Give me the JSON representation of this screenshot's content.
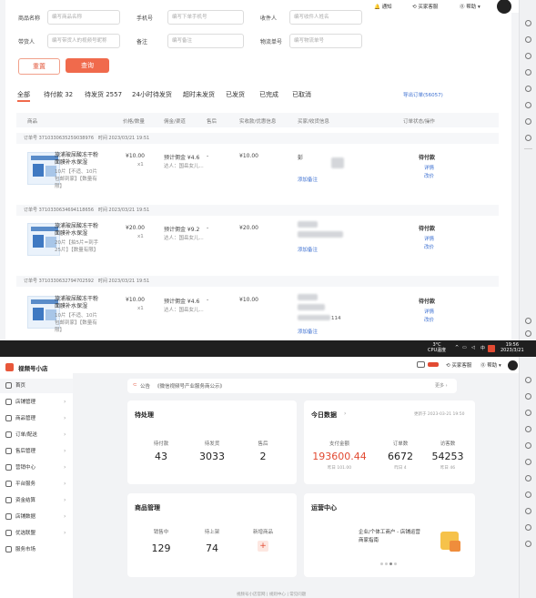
{
  "orders_page": {
    "header": {
      "notify": "通知",
      "service": "买家客服",
      "help": "帮助"
    },
    "filters": [
      {
        "label": "商品名称",
        "placeholder": "编写商品名称"
      },
      {
        "label": "手机号",
        "placeholder": "编写下单手机号"
      },
      {
        "label": "收件人",
        "placeholder": "编写收件人姓名"
      },
      {
        "label": "带货人",
        "placeholder": "编写带货人的视频号昵称"
      },
      {
        "label": "备注",
        "placeholder": "编写备注"
      },
      {
        "label": "物流单号",
        "placeholder": "编写物流单号"
      }
    ],
    "reset_label": "重置",
    "query_label": "查询",
    "tabs": [
      "全部",
      "待付款 32",
      "待发货 2557",
      "24小时待发货",
      "超时未发货",
      "已发货",
      "已完成",
      "已取消"
    ],
    "export_label": "导出订单(56057)",
    "columns": [
      "商品",
      "价格/数量",
      "佣金/渠道",
      "售后",
      "实收款/优惠信息",
      "买家/收货信息",
      "订单状态/操作"
    ],
    "orders": [
      {
        "order_no": "订单号 3710330635259038976",
        "time": "时间 2023/03/21 19:51",
        "title": "旅浦玻尿酸冻干粉面膜补水保湿",
        "sku": "10片【不适、10片包邮到家】【数量有限】",
        "price": "¥10.00",
        "qty": "x1",
        "commission": "预计佣金 ¥4.6",
        "channel": "达人：国岳女儿...",
        "aftersale": "-",
        "received": "¥10.00",
        "buyer": "彭",
        "address_tail": "",
        "remark": "添加备注",
        "status": "待付款",
        "action1": "详情",
        "action2": "改价"
      },
      {
        "order_no": "订单号 3710330634694118656",
        "time": "时间 2023/03/21 19:51",
        "title": "旅浦玻尿酸冻干粉面膜补水保湿",
        "sku": "20片【拍5片=到手25片】【数量有限】",
        "price": "¥20.00",
        "qty": "x1",
        "commission": "预计佣金 ¥9.2",
        "channel": "达人：国岳女儿...",
        "aftersale": "-",
        "received": "¥20.00",
        "buyer": "",
        "address_tail": "",
        "remark": "添加备注",
        "status": "待付款",
        "action1": "详情",
        "action2": "改价"
      },
      {
        "order_no": "订单号 3710330632794702592",
        "time": "时间 2023/03/21 19:51",
        "title": "旅浦玻尿酸冻干粉面膜补水保湿",
        "sku": "10片【不适、10片包邮到家】【数量有限】",
        "price": "¥10.00",
        "qty": "x1",
        "commission": "预计佣金 ¥4.6",
        "channel": "达人：国岳女儿...",
        "aftersale": "-",
        "received": "¥10.00",
        "buyer": "",
        "address_tail": "114",
        "remark": "添加备注",
        "status": "待付款",
        "action1": "详情",
        "action2": "改价"
      }
    ]
  },
  "taskbar": {
    "weather": "3°C",
    "weather_sub": "CPU温度",
    "time": "19:56",
    "date": "2023/3/21"
  },
  "dashboard": {
    "app_name": "视频号小店",
    "header": {
      "service": "买家客服",
      "help": "帮助"
    },
    "sidebar": [
      {
        "label": "首页",
        "chev": ""
      },
      {
        "label": "店铺管理",
        "chev": "›"
      },
      {
        "label": "商品管理",
        "chev": "›"
      },
      {
        "label": "订单/配送",
        "chev": "›"
      },
      {
        "label": "售后管理",
        "chev": "›"
      },
      {
        "label": "营销中心",
        "chev": "›"
      },
      {
        "label": "平台服务",
        "chev": "›"
      },
      {
        "label": "资金结算",
        "chev": "›"
      },
      {
        "label": "店铺数据",
        "chev": "›"
      },
      {
        "label": "优选联盟",
        "chev": "›"
      },
      {
        "label": "服务市场",
        "chev": ""
      }
    ],
    "notice_label": "公告",
    "notice_text": "《微信视频号产业服务商公示》",
    "notice_more": "更多 ›",
    "pending": {
      "title": "待处理",
      "items": [
        {
          "label": "待付款",
          "value": "43"
        },
        {
          "label": "待发货",
          "value": "3033"
        },
        {
          "label": "售后",
          "value": "2"
        }
      ]
    },
    "today": {
      "title": "今日数据",
      "updated": "更新于 2023-03-21 19:50",
      "items": [
        {
          "label": "支付金额",
          "value": "193600.44",
          "sub": "昨日 101.00",
          "highlight": true
        },
        {
          "label": "订单数",
          "value": "6672",
          "sub": "昨日 4",
          "highlight": false
        },
        {
          "label": "访客数",
          "value": "54253",
          "sub": "昨日 46",
          "highlight": false
        }
      ]
    },
    "goods": {
      "title": "商品管理",
      "items": [
        {
          "label": "销售中",
          "value": "129"
        },
        {
          "label": "待上架",
          "value": "74"
        },
        {
          "label": "新增商品",
          "value": "+"
        }
      ]
    },
    "ops": {
      "title": "运营中心",
      "line1": "企业/个体工商户 - 店铺运营",
      "line2": "商家指南"
    },
    "footer": [
      "视频号小店官网",
      "规则中心",
      "常见问题"
    ]
  },
  "colors": {
    "accent": "#f06a4c",
    "highlight": "#e24a32",
    "link": "#3b6fd1"
  }
}
